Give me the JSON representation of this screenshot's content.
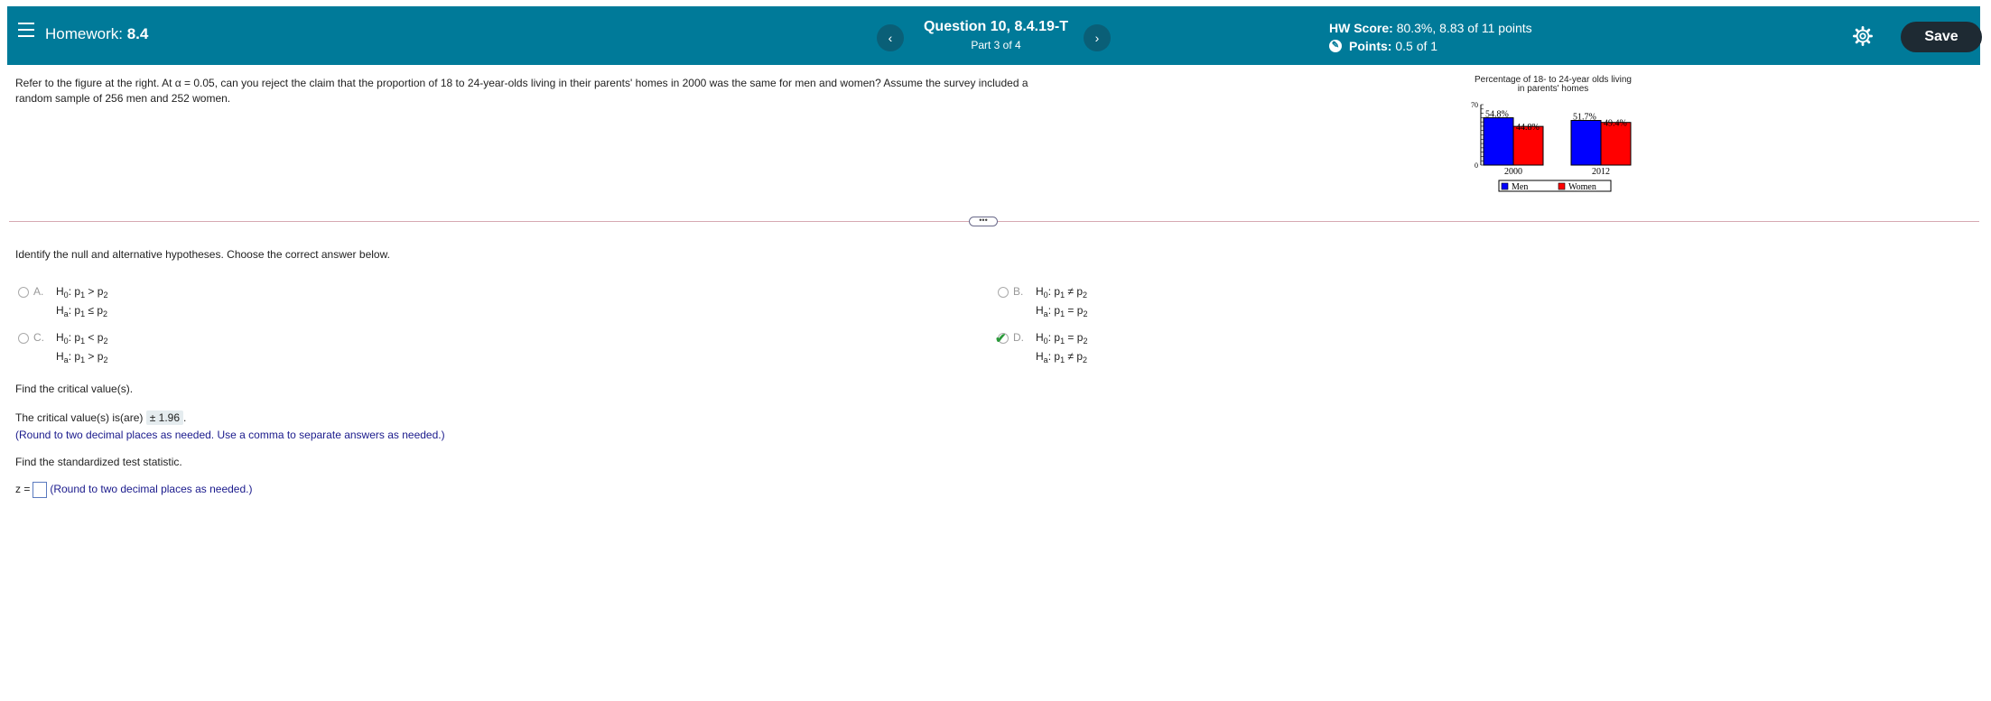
{
  "header": {
    "homework_prefix": "Homework:",
    "homework_number": "8.4",
    "question_title": "Question 10, 8.4.19-T",
    "question_part": "Part 3 of 4",
    "prev_label": "‹",
    "next_label": "›",
    "hw_score_label": "HW Score:",
    "hw_score_value": "80.3%, 8.83 of 11 points",
    "points_label": "Points:",
    "points_value": "0.5 of 1",
    "save_label": "Save"
  },
  "question": {
    "text_line1": "Refer to the figure at the right. At α = 0.05, can you  reject the claim that the proportion of 18 to 24-year-olds living in their parents' homes in 2000 was the same for men and women? Assume the survey included a",
    "text_line2": "random sample of 256 men and 252 women.",
    "instruction": "Identify the null and alternative hypotheses. Choose the correct answer below."
  },
  "divider_handle": "•••",
  "choices": [
    {
      "letter": "A.",
      "h0_rel": ">",
      "ha_rel": "≤",
      "selected": false
    },
    {
      "letter": "B.",
      "h0_rel": "≠",
      "ha_rel": "=",
      "selected": false
    },
    {
      "letter": "C.",
      "h0_rel": "<",
      "ha_rel": ">",
      "selected": false
    },
    {
      "letter": "D.",
      "h0_rel": "=",
      "ha_rel": "≠",
      "selected": true
    }
  ],
  "hyp_labels": {
    "h": "H",
    "h0_sub": "0",
    "ha_sub": "a",
    "p": "p",
    "s1": "1",
    "s2": "2",
    "colon": ":"
  },
  "critical": {
    "prompt": "Find the critical value(s).",
    "answer_prefix": "The critical value(s) is(are)",
    "answer_value": "± 1.96",
    "hint": "(Round to two decimal places as needed. Use a comma to separate answers as needed.)"
  },
  "test_stat": {
    "prompt": "Find the standardized test statistic.",
    "z_label": "z =",
    "hint": "(Round to two decimal places as needed.)"
  },
  "chart_data": {
    "type": "bar",
    "title": "Percentage of 18- to 24-year olds living in parents' homes",
    "title_line1": "Percentage of 18- to 24-year olds living",
    "title_line2": "in parents' homes",
    "categories": [
      "2000",
      "2012"
    ],
    "series": [
      {
        "name": "Men",
        "values": [
          54.8,
          51.7
        ],
        "color": "#0000ff"
      },
      {
        "name": "Women",
        "values": [
          44.8,
          49.4
        ],
        "color": "#ff0000"
      }
    ],
    "value_labels": [
      [
        "54.8%",
        "51.7%"
      ],
      [
        "44.8%",
        "49.4%"
      ]
    ],
    "ylim": [
      0,
      70
    ],
    "yticks": [
      "0",
      "70"
    ],
    "legend": "bottom"
  }
}
